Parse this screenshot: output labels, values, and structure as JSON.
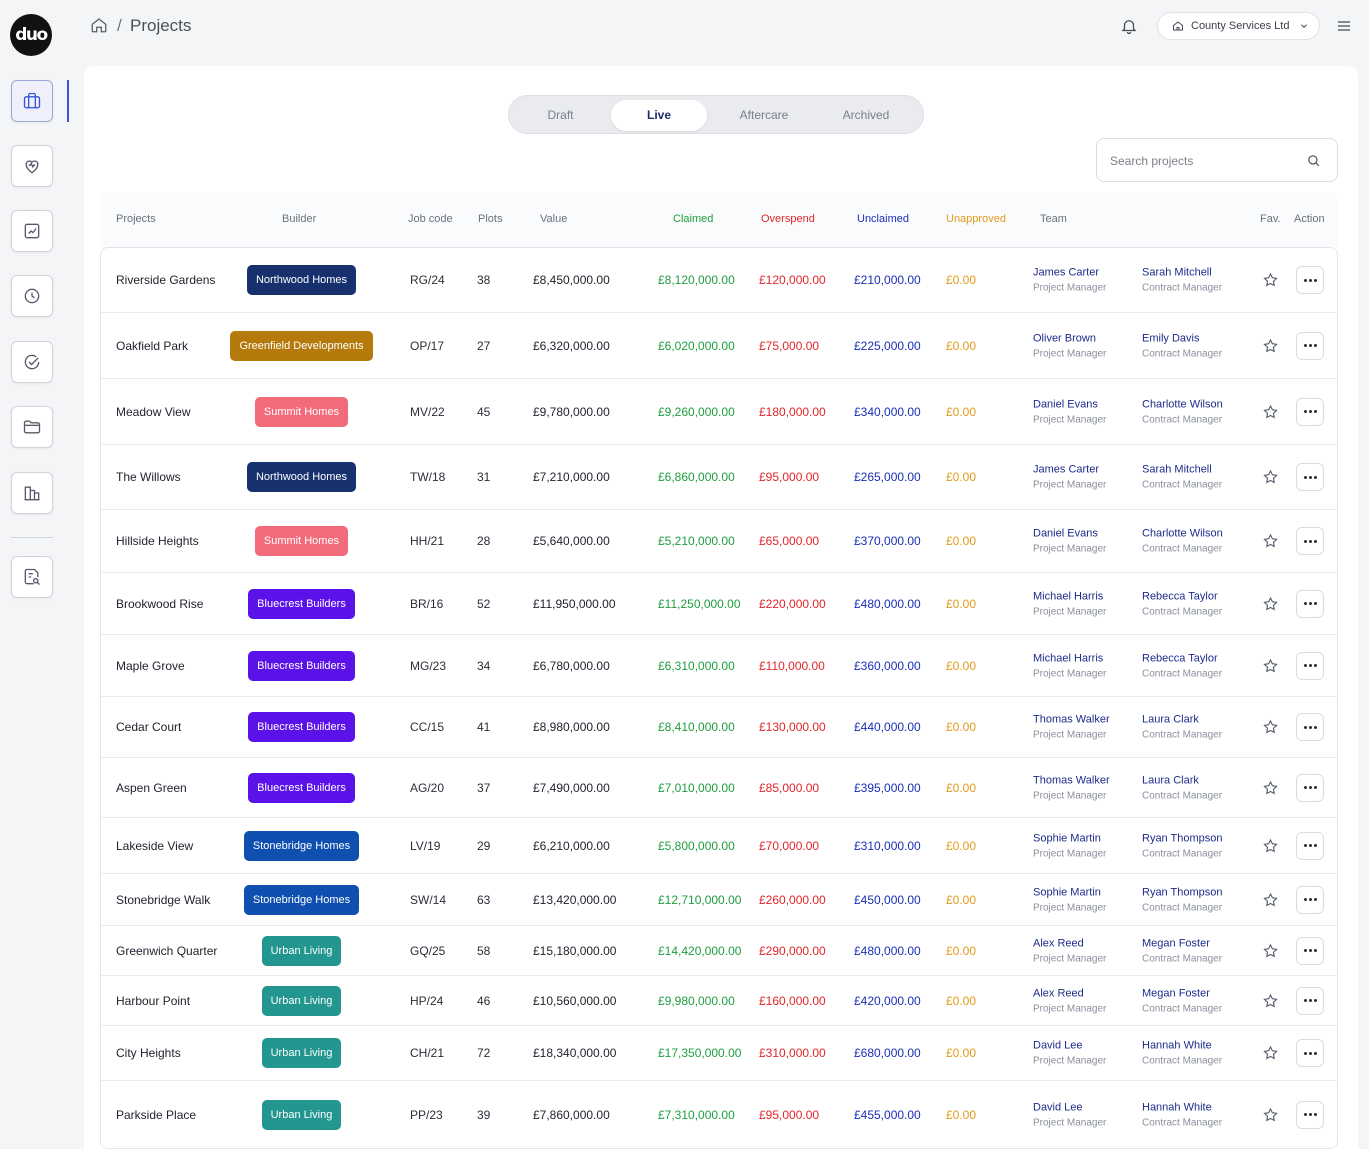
{
  "app": {
    "logo_text": "duo"
  },
  "sidebar": {
    "items": [
      {
        "name": "projects",
        "icon": "briefcase-icon",
        "active": true
      },
      {
        "name": "aftercare",
        "icon": "heart-icon",
        "active": false
      },
      {
        "name": "reports",
        "icon": "chart-square-icon",
        "active": false
      },
      {
        "name": "history",
        "icon": "clock-icon",
        "active": false
      },
      {
        "name": "approvals",
        "icon": "check-circle-icon",
        "active": false
      },
      {
        "name": "documents",
        "icon": "folder-icon",
        "active": false
      },
      {
        "name": "buildings",
        "icon": "buildings-icon",
        "active": false
      },
      {
        "name": "audit",
        "icon": "document-search-icon",
        "active": false
      }
    ]
  },
  "header": {
    "breadcrumb_sep": "/",
    "title": "Projects",
    "org_name": "County Services Ltd"
  },
  "tabs": [
    {
      "label": "Draft",
      "active": false
    },
    {
      "label": "Live",
      "active": true
    },
    {
      "label": "Aftercare",
      "active": false
    },
    {
      "label": "Archived",
      "active": false
    }
  ],
  "search": {
    "placeholder": "Search projects",
    "value": ""
  },
  "table": {
    "columns": {
      "projects": "Projects",
      "builder": "Builder",
      "job_code": "Job code",
      "plots": "Plots",
      "value": "Value",
      "claimed": "Claimed",
      "overspend": "Overspend",
      "unclaimed": "Unclaimed",
      "unapproved": "Unapproved",
      "team": "Team",
      "fav": "Fav.",
      "action": "Action"
    },
    "builder_colors": {
      "Northwood Homes": "#17306e",
      "Greenfield Developments": "#b5790c",
      "Summit Homes": "#f26b7a",
      "Bluecrest Builders": "#5a12e8",
      "Stonebridge Homes": "#0f4fb0",
      "Urban Living": "#23968f"
    },
    "rows": [
      {
        "name": "Riverside Gardens",
        "builder": "Northwood Homes",
        "job": "RG/24",
        "plots": "38",
        "value": "£8,450,000.00",
        "claimed": "£8,120,000.00",
        "overspend": "£120,000.00",
        "unclaimed": "£210,000.00",
        "unapproved": "£0.00",
        "pm": "James Carter",
        "pm_role": "Project Manager",
        "cm": "Sarah Mitchell",
        "cm_role": "Contract Manager"
      },
      {
        "name": "Oakfield Park",
        "builder": "Greenfield Developments",
        "job": "OP/17",
        "plots": "27",
        "value": "£6,320,000.00",
        "claimed": "£6,020,000.00",
        "overspend": "£75,000.00",
        "unclaimed": "£225,000.00",
        "unapproved": "£0.00",
        "pm": "Oliver Brown",
        "pm_role": "Project Manager",
        "cm": "Emily Davis",
        "cm_role": "Contract Manager"
      },
      {
        "name": "Meadow View",
        "builder": "Summit Homes",
        "job": "MV/22",
        "plots": "45",
        "value": "£9,780,000.00",
        "claimed": "£9,260,000.00",
        "overspend": "£180,000.00",
        "unclaimed": "£340,000.00",
        "unapproved": "£0.00",
        "pm": "Daniel Evans",
        "pm_role": "Project Manager",
        "cm": "Charlotte Wilson",
        "cm_role": "Contract Manager"
      },
      {
        "name": "The Willows",
        "builder": "Northwood Homes",
        "job": "TW/18",
        "plots": "31",
        "value": "£7,210,000.00",
        "claimed": "£6,860,000.00",
        "overspend": "£95,000.00",
        "unclaimed": "£265,000.00",
        "unapproved": "£0.00",
        "pm": "James Carter",
        "pm_role": "Project Manager",
        "cm": "Sarah Mitchell",
        "cm_role": "Contract Manager"
      },
      {
        "name": "Hillside Heights",
        "builder": "Summit Homes",
        "job": "HH/21",
        "plots": "28",
        "value": "£5,640,000.00",
        "claimed": "£5,210,000.00",
        "overspend": "£65,000.00",
        "unclaimed": "£370,000.00",
        "unapproved": "£0.00",
        "pm": "Daniel Evans",
        "pm_role": "Project Manager",
        "cm": "Charlotte Wilson",
        "cm_role": "Contract Manager"
      },
      {
        "name": "Brookwood Rise",
        "builder": "Bluecrest Builders",
        "job": "BR/16",
        "plots": "52",
        "value": "£11,950,000.00",
        "claimed": "£11,250,000.00",
        "overspend": "£220,000.00",
        "unclaimed": "£480,000.00",
        "unapproved": "£0.00",
        "pm": "Michael Harris",
        "pm_role": "Project Manager",
        "cm": "Rebecca Taylor",
        "cm_role": "Contract Manager"
      },
      {
        "name": "Maple Grove",
        "builder": "Bluecrest Builders",
        "job": "MG/23",
        "plots": "34",
        "value": "£6,780,000.00",
        "claimed": "£6,310,000.00",
        "overspend": "£110,000.00",
        "unclaimed": "£360,000.00",
        "unapproved": "£0.00",
        "pm": "Michael Harris",
        "pm_role": "Project Manager",
        "cm": "Rebecca Taylor",
        "cm_role": "Contract Manager"
      },
      {
        "name": "Cedar Court",
        "builder": "Bluecrest Builders",
        "job": "CC/15",
        "plots": "41",
        "value": "£8,980,000.00",
        "claimed": "£8,410,000.00",
        "overspend": "£130,000.00",
        "unclaimed": "£440,000.00",
        "unapproved": "£0.00",
        "pm": "Thomas Walker",
        "pm_role": "Project Manager",
        "cm": "Laura Clark",
        "cm_role": "Contract Manager"
      },
      {
        "name": "Aspen Green",
        "builder": "Bluecrest Builders",
        "job": "AG/20",
        "plots": "37",
        "value": "£7,490,000.00",
        "claimed": "£7,010,000.00",
        "overspend": "£85,000.00",
        "unclaimed": "£395,000.00",
        "unapproved": "£0.00",
        "pm": "Thomas Walker",
        "pm_role": "Project Manager",
        "cm": "Laura Clark",
        "cm_role": "Contract Manager"
      },
      {
        "name": "Lakeside View",
        "builder": "Stonebridge Homes",
        "job": "LV/19",
        "plots": "29",
        "value": "£6,210,000.00",
        "claimed": "£5,800,000.00",
        "overspend": "£70,000.00",
        "unclaimed": "£310,000.00",
        "unapproved": "£0.00",
        "pm": "Sophie Martin",
        "pm_role": "Project Manager",
        "cm": "Ryan Thompson",
        "cm_role": "Contract Manager"
      },
      {
        "name": "Stonebridge Walk",
        "builder": "Stonebridge Homes",
        "job": "SW/14",
        "plots": "63",
        "value": "£13,420,000.00",
        "claimed": "£12,710,000.00",
        "overspend": "£260,000.00",
        "unclaimed": "£450,000.00",
        "unapproved": "£0.00",
        "pm": "Sophie Martin",
        "pm_role": "Project Manager",
        "cm": "Ryan Thompson",
        "cm_role": "Contract Manager"
      },
      {
        "name": "Greenwich Quarter",
        "builder": "Urban Living",
        "job": "GQ/25",
        "plots": "58",
        "value": "£15,180,000.00",
        "claimed": "£14,420,000.00",
        "overspend": "£290,000.00",
        "unclaimed": "£480,000.00",
        "unapproved": "£0.00",
        "pm": "Alex Reed",
        "pm_role": "Project Manager",
        "cm": "Megan Foster",
        "cm_role": "Contract Manager"
      },
      {
        "name": "Harbour Point",
        "builder": "Urban Living",
        "job": "HP/24",
        "plots": "46",
        "value": "£10,560,000.00",
        "claimed": "£9,980,000.00",
        "overspend": "£160,000.00",
        "unclaimed": "£420,000.00",
        "unapproved": "£0.00",
        "pm": "Alex Reed",
        "pm_role": "Project Manager",
        "cm": "Megan Foster",
        "cm_role": "Contract Manager"
      },
      {
        "name": "City Heights",
        "builder": "Urban Living",
        "job": "CH/21",
        "plots": "72",
        "value": "£18,340,000.00",
        "claimed": "£17,350,000.00",
        "overspend": "£310,000.00",
        "unclaimed": "£680,000.00",
        "unapproved": "£0.00",
        "pm": "David Lee",
        "pm_role": "Project Manager",
        "cm": "Hannah White",
        "cm_role": "Contract Manager"
      },
      {
        "name": "Parkside Place",
        "builder": "Urban Living",
        "job": "PP/23",
        "plots": "39",
        "value": "£7,860,000.00",
        "claimed": "£7,310,000.00",
        "overspend": "£95,000.00",
        "unclaimed": "£455,000.00",
        "unapproved": "£0.00",
        "pm": "David Lee",
        "pm_role": "Project Manager",
        "cm": "Hannah White",
        "cm_role": "Contract Manager"
      }
    ]
  }
}
